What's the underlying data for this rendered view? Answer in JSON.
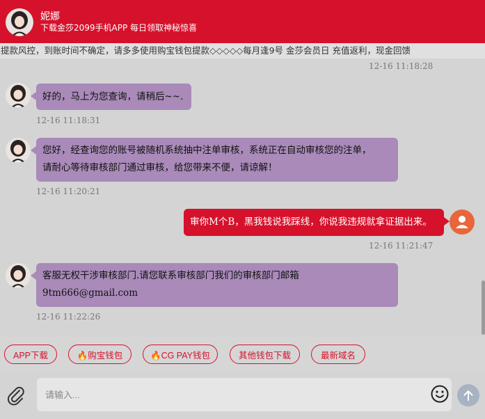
{
  "header": {
    "agent_name": "妮娜",
    "subtitle": "下载金莎2099手机APP 每日领取神秘惊喜"
  },
  "notice": {
    "text": "提款风控，到账时间不确定，请多多使用购宝钱包提款◇◇◇◇◇每月逢9号 金莎会员日 充值返利，现金回馈"
  },
  "messages": [
    {
      "type": "timestamp",
      "time": "12-16 11:18:28"
    },
    {
      "from": "agent",
      "text": "好的，马上为您查询，请稍后~~.",
      "time": "12-16 11:18:31"
    },
    {
      "from": "agent",
      "lines": [
        "您好，经查询您的账号被随机系统抽中注单审核，系统正在自动审核您的注单，",
        "请耐心等待审核部门通过审核，给您带来不便，请谅解！"
      ],
      "time": "12-16 11:20:21"
    },
    {
      "from": "user",
      "text": "审你M个B，黑我钱说我踩线，你说我违规就拿证据出来。",
      "time": "12-16 11:21:47"
    },
    {
      "from": "agent",
      "lines": [
        "客服无权干涉审核部门.请您联系审核部门我们的审核部门邮箱",
        "9tm666@gmail.com"
      ],
      "time": "12-16 11:22:26"
    }
  ],
  "quick_actions": [
    {
      "label": "APP下载"
    },
    {
      "label": "🔥购宝钱包"
    },
    {
      "label": "🔥CG PAY钱包"
    },
    {
      "label": "其他钱包下载"
    },
    {
      "label": "最新域名"
    }
  ],
  "composer": {
    "placeholder": "请输入..."
  },
  "colors": {
    "brand_red": "#d6112b",
    "agent_bubble": "#a98ab9",
    "user_avatar": "#e8663a",
    "send_button": "#a7b2c2"
  },
  "icons": {
    "attach": "paperclip-icon",
    "emoji": "smiley-icon",
    "send": "arrow-up-icon"
  }
}
